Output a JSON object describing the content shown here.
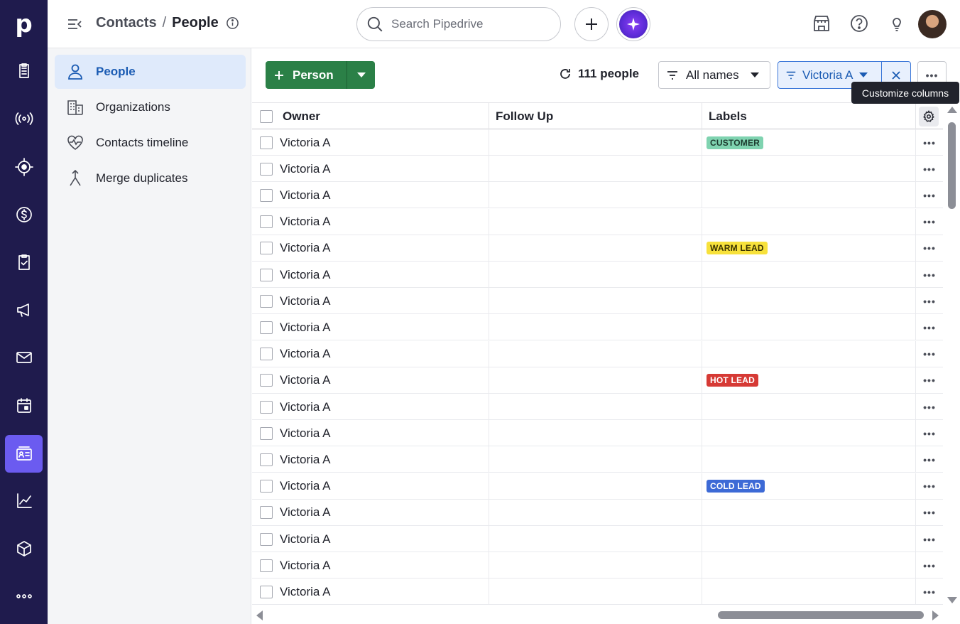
{
  "rail": {
    "logo": "p",
    "items": [
      {
        "icon": "clipboard-list-icon"
      },
      {
        "icon": "broadcast-icon"
      },
      {
        "icon": "target-icon"
      },
      {
        "icon": "dollar-circle-icon"
      },
      {
        "icon": "task-check-icon"
      },
      {
        "icon": "megaphone-icon"
      },
      {
        "icon": "mail-icon"
      },
      {
        "icon": "calendar-icon"
      },
      {
        "icon": "contacts-card-icon",
        "active": true
      },
      {
        "icon": "chart-line-icon"
      },
      {
        "icon": "box-icon"
      },
      {
        "icon": "more-dots-icon"
      }
    ]
  },
  "breadcrumb": {
    "parent": "Contacts",
    "separator": "/",
    "current": "People"
  },
  "search": {
    "placeholder": "Search Pipedrive"
  },
  "subnav": {
    "items": [
      {
        "label": "People",
        "icon": "person-icon",
        "active": true
      },
      {
        "label": "Organizations",
        "icon": "building-icon"
      },
      {
        "label": "Contacts timeline",
        "icon": "heart-pulse-icon"
      },
      {
        "label": "Merge duplicates",
        "icon": "merge-icon"
      }
    ]
  },
  "toolbar": {
    "add_label": "Person",
    "count_label": "111 people",
    "filter_label": "All names",
    "owner_filter_label": "Victoria A",
    "tooltip": "Customize columns"
  },
  "table": {
    "columns": [
      "Owner",
      "Follow Up",
      "Labels"
    ],
    "rows": [
      {
        "owner": "Victoria A",
        "follow_up": "",
        "label": "CUSTOMER"
      },
      {
        "owner": "Victoria A",
        "follow_up": "",
        "label": ""
      },
      {
        "owner": "Victoria A",
        "follow_up": "",
        "label": ""
      },
      {
        "owner": "Victoria A",
        "follow_up": "",
        "label": ""
      },
      {
        "owner": "Victoria A",
        "follow_up": "",
        "label": "WARM LEAD"
      },
      {
        "owner": "Victoria A",
        "follow_up": "",
        "label": ""
      },
      {
        "owner": "Victoria A",
        "follow_up": "",
        "label": ""
      },
      {
        "owner": "Victoria A",
        "follow_up": "",
        "label": ""
      },
      {
        "owner": "Victoria A",
        "follow_up": "",
        "label": ""
      },
      {
        "owner": "Victoria A",
        "follow_up": "",
        "label": "HOT LEAD"
      },
      {
        "owner": "Victoria A",
        "follow_up": "",
        "label": ""
      },
      {
        "owner": "Victoria A",
        "follow_up": "",
        "label": ""
      },
      {
        "owner": "Victoria A",
        "follow_up": "",
        "label": ""
      },
      {
        "owner": "Victoria A",
        "follow_up": "",
        "label": "COLD LEAD"
      },
      {
        "owner": "Victoria A",
        "follow_up": "",
        "label": ""
      },
      {
        "owner": "Victoria A",
        "follow_up": "",
        "label": ""
      },
      {
        "owner": "Victoria A",
        "follow_up": "",
        "label": ""
      },
      {
        "owner": "Victoria A",
        "follow_up": "",
        "label": ""
      },
      {
        "owner": "",
        "follow_up": "",
        "label": ""
      }
    ],
    "label_styles": {
      "CUSTOMER": {
        "bg": "#7fd3b0",
        "fg": "#1d3b2f"
      },
      "WARM LEAD": {
        "bg": "#f7e13b",
        "fg": "#3a3200"
      },
      "HOT LEAD": {
        "bg": "#d63a35",
        "fg": "#ffffff"
      },
      "COLD LEAD": {
        "bg": "#3d6ad6",
        "fg": "#ffffff"
      }
    }
  },
  "colors": {
    "rail_bg": "#1f1b4d",
    "rail_active": "#6b5bf0",
    "primary_green": "#2b8047",
    "link_blue": "#1a5bb3"
  }
}
